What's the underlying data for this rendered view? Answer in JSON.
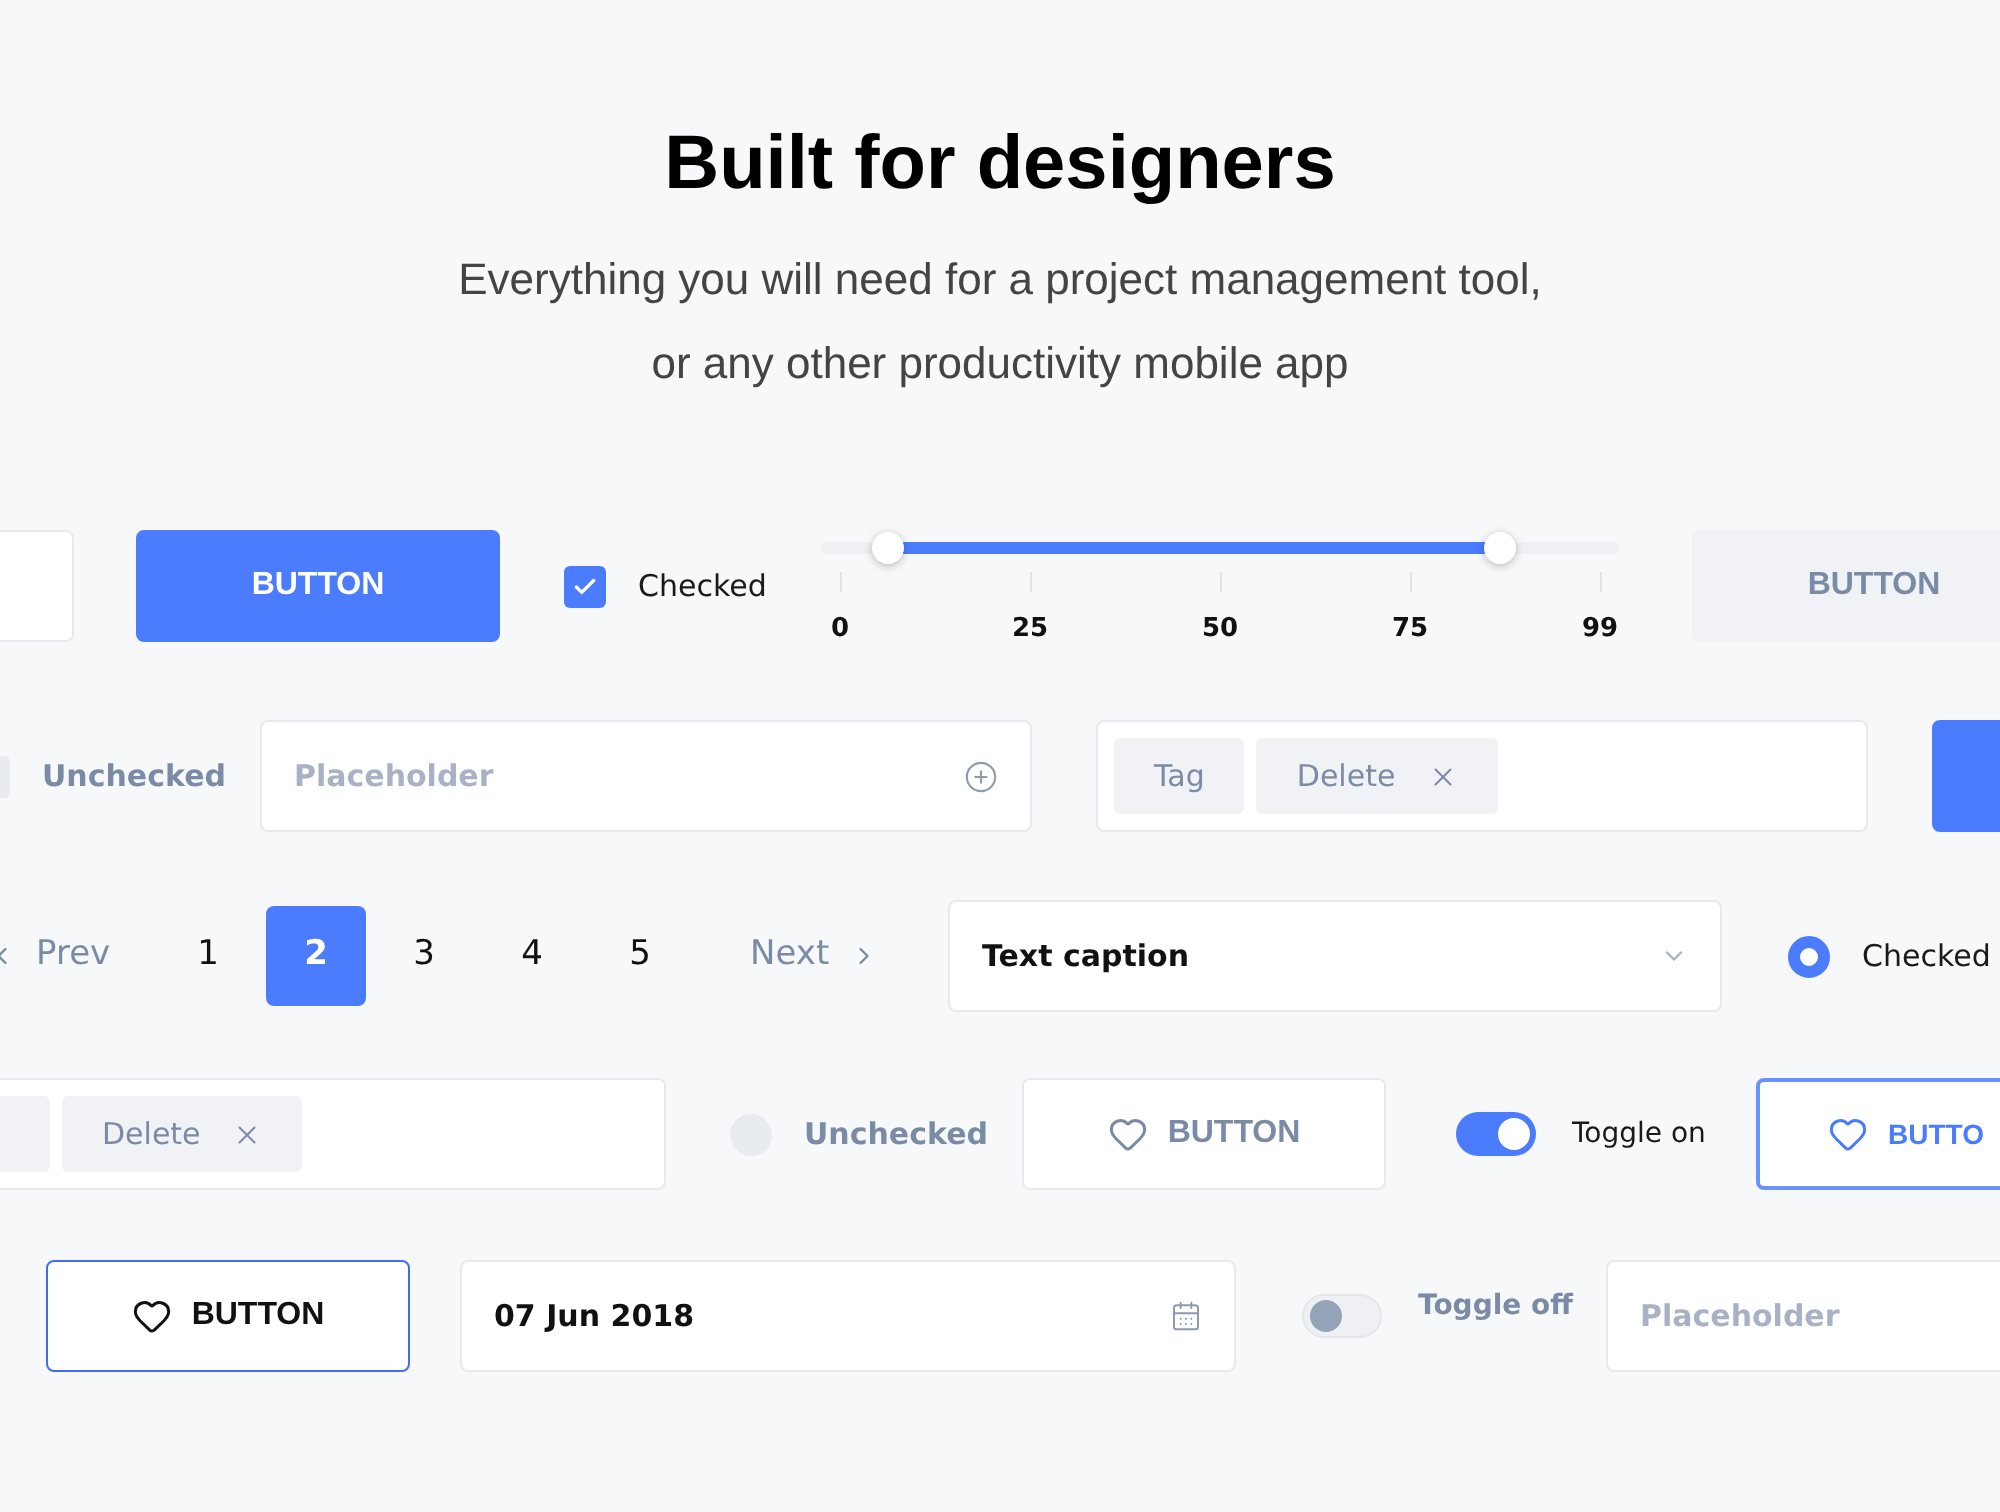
{
  "header": {
    "title": "Built for designers",
    "subtitle_lines": [
      "Everything you will need for a project management tool,",
      "or any other productivity mobile app"
    ]
  },
  "rows": [
    {
      "items": [
        {
          "kind": "text_field"
        },
        {
          "kind": "primary_button",
          "label": "BUTTON"
        },
        {
          "kind": "checkbox",
          "label": "Checked",
          "checked": true
        },
        {
          "kind": "range_slider",
          "handles": [
            {
              "level": 0.085
            },
            {
              "level": 0.85
            }
          ],
          "ticks": [
            "0",
            "25",
            "50",
            "75",
            "99"
          ]
        },
        {
          "kind": "secondary_button",
          "label": "BUTTON"
        }
      ]
    },
    {
      "items": [
        {
          "kind": "checkbox",
          "label": "Unchecked",
          "checked": false
        },
        {
          "kind": "add_field",
          "placeholder": "Placeholder"
        },
        {
          "kind": "tag_field",
          "tags": [
            {
              "label": "Tag",
              "removable": false
            },
            {
              "label": "Delete",
              "removable": true
            }
          ]
        },
        {
          "kind": "primary_button"
        }
      ]
    },
    {
      "items": [
        {
          "kind": "pagination",
          "prev": "Prev",
          "next": "Next",
          "pages": [
            {
              "label": "1",
              "selected": false
            },
            {
              "label": "2",
              "selected": true
            },
            {
              "label": "3",
              "selected": false
            },
            {
              "label": "4",
              "selected": false
            },
            {
              "label": "5",
              "selected": false
            }
          ]
        },
        {
          "kind": "select",
          "value": "Text caption"
        },
        {
          "kind": "radio",
          "label": "Checked",
          "checked": true
        }
      ]
    },
    {
      "items": [
        {
          "kind": "tag_field",
          "tags": [
            {
              "removable": false
            },
            {
              "label": "Delete",
              "removable": true
            }
          ]
        },
        {
          "kind": "radio",
          "label": "Unchecked",
          "checked": false
        },
        {
          "kind": "ghost_button",
          "label": "BUTTON"
        },
        {
          "kind": "toggle",
          "label": "Toggle on",
          "on": true
        },
        {
          "kind": "outline_button",
          "label": "BUTTO"
        }
      ]
    },
    {
      "items": [
        {
          "kind": "dark_outline_button",
          "label": "BUTTON"
        },
        {
          "kind": "date_field",
          "value": "07 Jun 2018"
        },
        {
          "kind": "toggle",
          "label": "Toggle off",
          "on": false
        },
        {
          "kind": "text_field",
          "placeholder": "Placeholder"
        }
      ]
    }
  ]
}
